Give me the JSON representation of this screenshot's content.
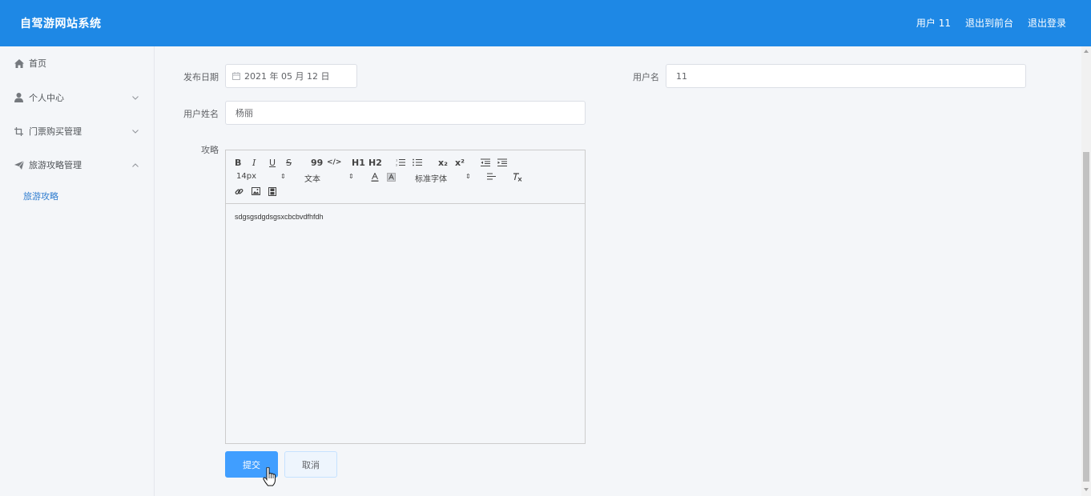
{
  "header": {
    "title": "自驾游网站系统",
    "user": "用户 11",
    "to_front": "退出到前台",
    "logout": "退出登录"
  },
  "sidebar": {
    "items": [
      {
        "label": "首页",
        "icon": "home-icon"
      },
      {
        "label": "个人中心",
        "icon": "user-icon",
        "expanded": false
      },
      {
        "label": "门票购买管理",
        "icon": "crop-icon",
        "expanded": false
      },
      {
        "label": "旅游攻略管理",
        "icon": "send-icon",
        "expanded": true
      }
    ],
    "sub_items": [
      "旅游攻略"
    ]
  },
  "form": {
    "publish_date_label": "发布日期",
    "publish_date_value": "2021 年 05 月 12 日",
    "username_label": "用户名",
    "username_value": "11",
    "realname_label": "用户姓名",
    "realname_value": "杨丽",
    "guide_label": "攻略",
    "guide_content": "sdgsgsdgdsgsxcbcbvdfhfdh",
    "submit": "提交",
    "cancel": "取消"
  },
  "editor_toolbar": {
    "bold": "B",
    "italic": "I",
    "underline": "U",
    "strike": "S",
    "blockquote": "99",
    "code": "</>",
    "h1": "H1",
    "h2": "H2",
    "subscript": "x₂",
    "superscript": "x²",
    "size": "14px",
    "header": "文本",
    "font": "标准字体"
  },
  "colors": {
    "header_bg": "#1e88e5",
    "primary": "#409eff",
    "active_sub": "#2e7ccf"
  }
}
